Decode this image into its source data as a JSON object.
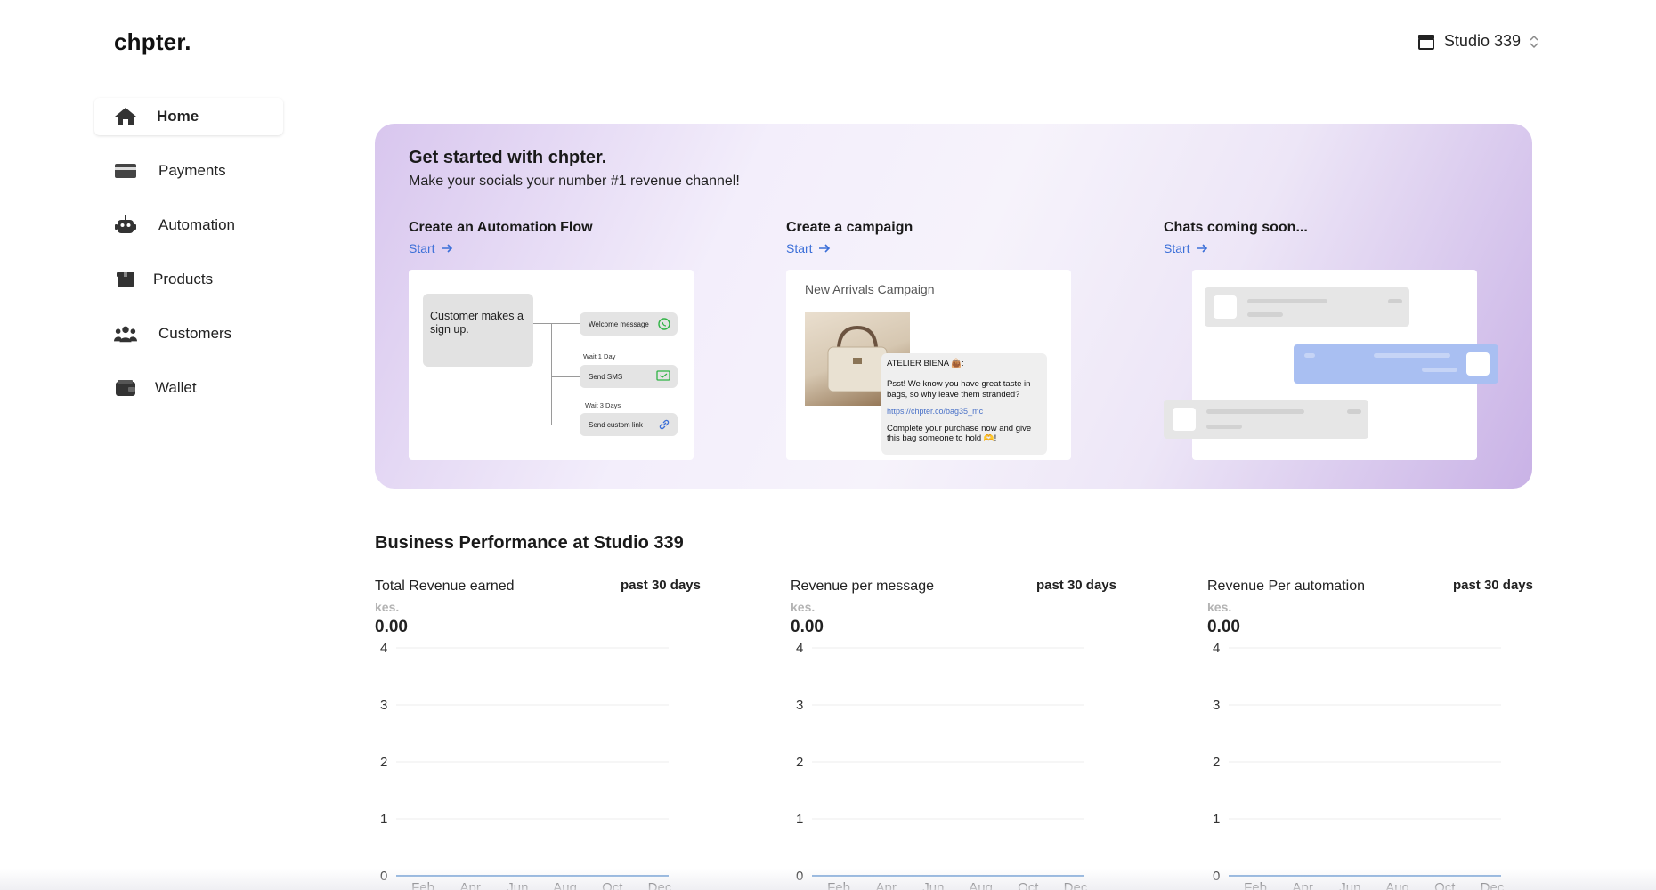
{
  "app": {
    "logo": "chpter."
  },
  "store": {
    "name": "Studio 339",
    "icon": "store-icon",
    "chevron": "chevron-updown-icon"
  },
  "sidebar": {
    "items": [
      {
        "label": "Home",
        "icon": "home-icon",
        "active": true
      },
      {
        "label": "Payments",
        "icon": "card-icon"
      },
      {
        "label": "Automation",
        "icon": "robot-icon"
      },
      {
        "label": "Products",
        "icon": "box-icon"
      },
      {
        "label": "Customers",
        "icon": "users-icon"
      },
      {
        "label": "Wallet",
        "icon": "wallet-icon"
      }
    ]
  },
  "hero": {
    "title": "Get started with chpter.",
    "subtitle": "Make your socials your number #1 revenue channel!",
    "cards": [
      {
        "title": "Create an Automation Flow",
        "start": "Start",
        "flow": {
          "trigger": "Customer makes a sign up.",
          "step1": "Welcome message",
          "wait1": "Wait 1 Day",
          "step2": "Send SMS",
          "wait2": "Wait 3 Days",
          "step3": "Send custom link"
        }
      },
      {
        "title": "Create a campaign",
        "start": "Start",
        "campaign": {
          "name": "New Arrivals Campaign",
          "brand": "ATELIER BIENA 👜:",
          "message": "Psst! We know you have great taste in bags, so why leave them stranded?",
          "link": "https://chpter.co/bag35_mc",
          "cta": "Complete your purchase now and give this bag someone to hold 🫶!"
        }
      },
      {
        "title": "Chats coming soon...",
        "start": "Start"
      }
    ]
  },
  "performance": {
    "title": "Business Performance at Studio 339",
    "metrics": [
      {
        "label": "Total Revenue earned",
        "period": "past 30 days",
        "unit": "kes.",
        "value": "0.00"
      },
      {
        "label": "Revenue per message",
        "period": "past 30 days",
        "unit": "kes.",
        "value": "0.00"
      },
      {
        "label": "Revenue Per automation",
        "period": "past 30 days",
        "unit": "kes.",
        "value": "0.00"
      }
    ]
  },
  "chart_data": [
    {
      "type": "line",
      "title": "Total Revenue earned",
      "categories": [
        "Feb",
        "Apr",
        "Jun",
        "Aug",
        "Oct",
        "Dec"
      ],
      "series": [
        {
          "values": [
            0,
            0,
            0,
            0,
            0,
            0
          ]
        }
      ],
      "yticks": [
        0,
        1,
        2,
        3,
        4
      ],
      "ylim": [
        0,
        4
      ],
      "grid": true
    },
    {
      "type": "line",
      "title": "Revenue per message",
      "categories": [
        "Feb",
        "Apr",
        "Jun",
        "Aug",
        "Oct",
        "Dec"
      ],
      "series": [
        {
          "values": [
            0,
            0,
            0,
            0,
            0,
            0
          ]
        }
      ],
      "yticks": [
        0,
        1,
        2,
        3,
        4
      ],
      "ylim": [
        0,
        4
      ],
      "grid": true
    },
    {
      "type": "line",
      "title": "Revenue Per automation",
      "categories": [
        "Feb",
        "Apr",
        "Jun",
        "Aug",
        "Oct",
        "Dec"
      ],
      "series": [
        {
          "values": [
            0,
            0,
            0,
            0,
            0,
            0
          ]
        }
      ],
      "yticks": [
        0,
        1,
        2,
        3,
        4
      ],
      "ylim": [
        0,
        4
      ],
      "grid": true
    }
  ],
  "colors": {
    "accent": "#3b6fd8",
    "line": "#7fa9d9",
    "hero_purple": "#c9b2e6"
  }
}
